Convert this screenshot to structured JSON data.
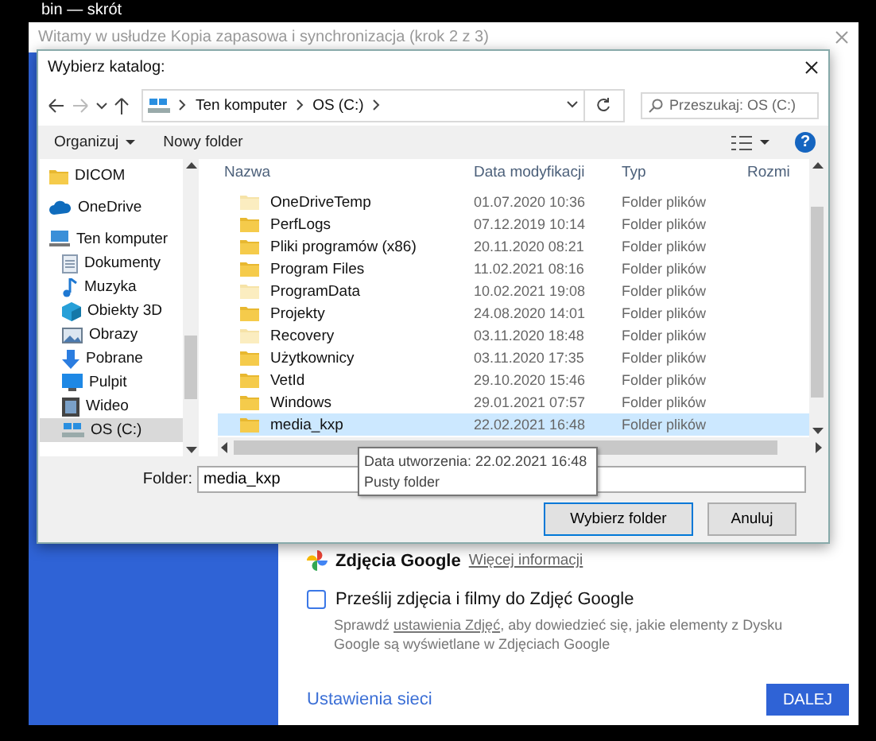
{
  "desktop": {
    "shortcut_label": "bin — skrót"
  },
  "backup_window": {
    "title": "Witamy w usłudze Kopia zapasowa i synchronizacja (krok 2 z 3)",
    "photos": {
      "title": "Zdjęcia Google",
      "link": "Więcej informacji"
    },
    "upload_option": {
      "label": "Prześlij zdjęcia i filmy do Zdjęć Google",
      "checked": false,
      "description": "Sprawdź **ustawienia Zdjęć**, aby dowiedzieć się, jakie elementy z Dysku Google są wyświetlane w Zdjęciach Google"
    },
    "network_link": "Ustawienia sieci",
    "next_button": "DALEJ"
  },
  "dialog": {
    "title": "Wybierz katalog:",
    "breadcrumb": [
      "Ten komputer",
      "OS (C:)"
    ],
    "search": {
      "placeholder": "Przeszukaj: OS (C:)"
    },
    "toolbar": {
      "organize": "Organizuj",
      "new_folder": "Nowy folder",
      "help": "?"
    },
    "nav_items": [
      {
        "label": "DICOM",
        "kind": "folder",
        "selected": false
      },
      {
        "label": "OneDrive",
        "kind": "cloud",
        "selected": false
      },
      {
        "label": "Ten komputer",
        "kind": "computer",
        "selected": false,
        "children": [
          {
            "label": "Dokumenty",
            "kind": "documents",
            "selected": false
          },
          {
            "label": "Muzyka",
            "kind": "music",
            "selected": false
          },
          {
            "label": "Obiekty 3D",
            "kind": "cube",
            "selected": false
          },
          {
            "label": "Obrazy",
            "kind": "pictures",
            "selected": false
          },
          {
            "label": "Pobrane",
            "kind": "download",
            "selected": false
          },
          {
            "label": "Pulpit",
            "kind": "desktop",
            "selected": false
          },
          {
            "label": "Wideo",
            "kind": "video",
            "selected": false
          },
          {
            "label": "OS (C:)",
            "kind": "drive",
            "selected": true
          }
        ]
      }
    ],
    "columns": [
      "Nazwa",
      "Data modyfikacji",
      "Typ",
      "Rozmi"
    ],
    "rows": [
      {
        "name": "OneDriveTemp",
        "date": "01.07.2020 10:36",
        "type": "Folder plików",
        "hidden": true,
        "selected": false
      },
      {
        "name": "PerfLogs",
        "date": "07.12.2019 10:14",
        "type": "Folder plików",
        "hidden": false,
        "selected": false
      },
      {
        "name": "Pliki programów (x86)",
        "date": "20.11.2020 08:21",
        "type": "Folder plików",
        "hidden": false,
        "selected": false
      },
      {
        "name": "Program Files",
        "date": "11.02.2021 08:16",
        "type": "Folder plików",
        "hidden": false,
        "selected": false
      },
      {
        "name": "ProgramData",
        "date": "10.02.2021 19:08",
        "type": "Folder plików",
        "hidden": true,
        "selected": false
      },
      {
        "name": "Projekty",
        "date": "24.08.2020 14:01",
        "type": "Folder plików",
        "hidden": false,
        "selected": false
      },
      {
        "name": "Recovery",
        "date": "03.11.2020 18:48",
        "type": "Folder plików",
        "hidden": true,
        "selected": false
      },
      {
        "name": "Użytkownicy",
        "date": "03.11.2020 17:35",
        "type": "Folder plików",
        "hidden": false,
        "selected": false
      },
      {
        "name": "VetId",
        "date": "29.10.2020 15:46",
        "type": "Folder plików",
        "hidden": false,
        "selected": false
      },
      {
        "name": "Windows",
        "date": "29.01.2021 07:57",
        "type": "Folder plików",
        "hidden": false,
        "selected": false
      },
      {
        "name": "media_kxp",
        "date": "22.02.2021 16:48",
        "type": "Folder plików",
        "hidden": false,
        "selected": true
      }
    ],
    "tooltip": [
      "Data utworzenia: 22.02.2021 16:48",
      "Pusty folder"
    ],
    "folder_label": "Folder:",
    "folder_value": "media_kxp",
    "select_button": "Wybierz folder",
    "cancel_button": "Anuluj"
  }
}
